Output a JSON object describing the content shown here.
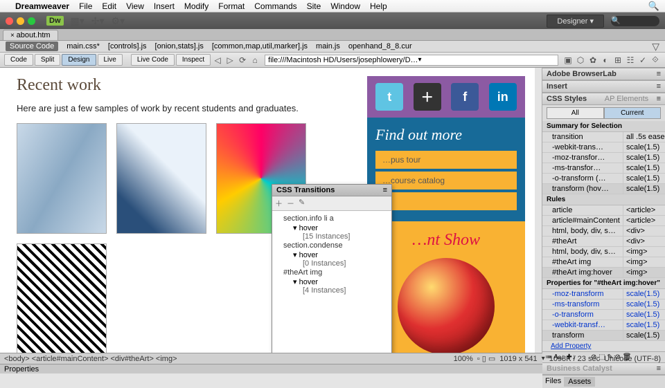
{
  "menubar": {
    "app": "Dreamweaver",
    "items": [
      "File",
      "Edit",
      "View",
      "Insert",
      "Modify",
      "Format",
      "Commands",
      "Site",
      "Window",
      "Help"
    ]
  },
  "workspace": "Designer",
  "tab": "about.htm",
  "related": {
    "source": "Source Code",
    "files": [
      "main.css*",
      "[controls].js",
      "[onion,stats].js",
      "[common,map,util,marker].js",
      "main.js",
      "openhand_8_8.cur"
    ]
  },
  "viewbar": {
    "code": "Code",
    "split": "Split",
    "design": "Design",
    "live": "Live",
    "livecode": "Live Code",
    "inspect": "Inspect",
    "address": "file:///Macintosh HD/Users/josephlowery/D…"
  },
  "page": {
    "heading": "Recent work",
    "intro": "Here are just a few samples of work by recent students and graduates.",
    "find": {
      "title": "Find out more",
      "b1": "…pus tour",
      "b2": "…course catalog"
    },
    "show": {
      "title": "…nt Show"
    }
  },
  "transitions": {
    "title": "CSS Transitions",
    "nodes": [
      {
        "sel": "section.info li a",
        "state": "hover",
        "count": "[15 Instances]"
      },
      {
        "sel": "section.condense",
        "state": "hover",
        "count": "[0 Instances]"
      },
      {
        "sel": "#theArt img",
        "state": "hover",
        "count": "[4 Instances]"
      }
    ]
  },
  "panels": {
    "browserlab": "Adobe BrowserLab",
    "insert": "Insert",
    "css": "CSS Styles",
    "ap": "AP Elements",
    "all": "All",
    "current": "Current",
    "summary": "Summary for Selection",
    "summaryRows": [
      {
        "k": "transition",
        "v": "all .5s ease"
      },
      {
        "k": "-webkit-trans…",
        "v": "scale(1.5)"
      },
      {
        "k": "-moz-transfor…",
        "v": "scale(1.5)"
      },
      {
        "k": "-ms-transfor…",
        "v": "scale(1.5)"
      },
      {
        "k": "-o-transform (…",
        "v": "scale(1.5)"
      },
      {
        "k": "transform (hov…",
        "v": "scale(1.5)"
      }
    ],
    "rules": "Rules",
    "ruleRows": [
      {
        "k": "article",
        "v": "<article>"
      },
      {
        "k": "article#mainContent",
        "v": "<article>"
      },
      {
        "k": "html, body, div, section…",
        "v": "<div>"
      },
      {
        "k": "#theArt",
        "v": "<div>"
      },
      {
        "k": "html, body, div, section…",
        "v": "<img>"
      },
      {
        "k": "#theArt img",
        "v": "<img>"
      },
      {
        "k": "#theArt img:hover",
        "v": "<img>"
      }
    ],
    "propsFor": "Properties for \"#theArt img:hover\"",
    "propRows": [
      {
        "k": "-moz-transform",
        "v": "scale(1.5)"
      },
      {
        "k": "-ms-transform",
        "v": "scale(1.5)"
      },
      {
        "k": "-o-transform",
        "v": "scale(1.5)"
      },
      {
        "k": "-webkit-transf…",
        "v": "scale(1.5)"
      },
      {
        "k": "transform",
        "v": "scale(1.5)"
      }
    ],
    "addProp": "Add Property",
    "files": "Files",
    "assets": "Assets"
  },
  "status": {
    "tags": "<body> <article#mainContent> <div#theArt> <img>",
    "zoom": "100%",
    "dims": "1019 x 541",
    "size": "1098K / 23 sec",
    "enc": "Unicode (UTF-8)",
    "props": "Properties"
  }
}
